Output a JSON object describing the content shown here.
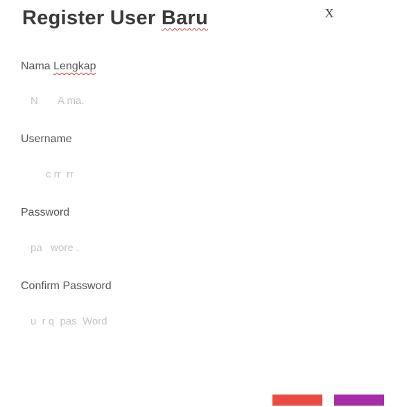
{
  "dialog": {
    "title_prefix": "Register User",
    "title_marked": "Baru",
    "close_label": "X"
  },
  "fields": [
    {
      "label_prefix": "Nama",
      "label_marked": "Lengkap",
      "placeholder": "N       A ma."
    },
    {
      "label_prefix": "Username",
      "label_marked": "",
      "placeholder": "c rr  rr"
    },
    {
      "label_prefix": "Password",
      "label_marked": "",
      "placeholder": "pa   wore ."
    },
    {
      "label_prefix": "Confirm Password",
      "label_marked": "",
      "placeholder": "u  r q  pas  Word"
    }
  ],
  "buttons": {
    "cancel_color": "#ea4a40",
    "submit_color": "#a62ca8"
  }
}
